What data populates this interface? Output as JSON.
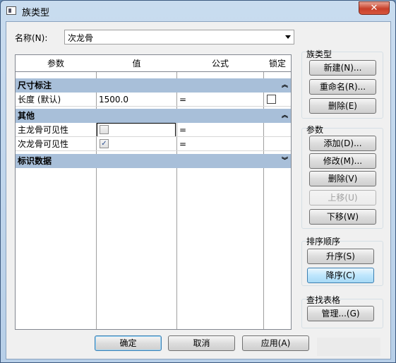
{
  "window": {
    "title": "族类型",
    "close_glyph": "✕"
  },
  "name_field": {
    "label": "名称(N):",
    "value": "次龙骨"
  },
  "table": {
    "headers": [
      "参数",
      "值",
      "公式",
      "锁定"
    ],
    "groups": [
      {
        "title": "尺寸标注",
        "chevron": "︽",
        "rows": [
          {
            "param": "长度 (默认)",
            "value": "1500.0",
            "formula": "=",
            "lock": "unchecked"
          }
        ]
      },
      {
        "title": "其他",
        "chevron": "︽",
        "rows": [
          {
            "param": "主龙骨可见性",
            "value": "unchecked",
            "formula": "="
          },
          {
            "param": "次龙骨可见性",
            "value": "checked",
            "formula": "="
          }
        ]
      },
      {
        "title": "标识数据",
        "chevron": "︾",
        "rows": []
      }
    ],
    "check_glyph": "✓"
  },
  "family_types": {
    "title": "族类型",
    "new_button": "新建(N)...",
    "rename_button": "重命名(R)...",
    "delete_button": "删除(E)"
  },
  "parameters": {
    "title": "参数",
    "add_button": "添加(D)...",
    "modify_button": "修改(M)...",
    "delete_button": "删除(V)",
    "move_up_button": "上移(U)",
    "move_down_button": "下移(W)"
  },
  "sort_order": {
    "title": "排序顺序",
    "ascending_button": "升序(S)",
    "descending_button": "降序(C)"
  },
  "lookup_tables": {
    "title": "查找表格",
    "manage_button": "管理...(G)"
  },
  "footer": {
    "ok_button": "确定",
    "cancel_button": "取消",
    "apply_button": "应用(A)"
  }
}
